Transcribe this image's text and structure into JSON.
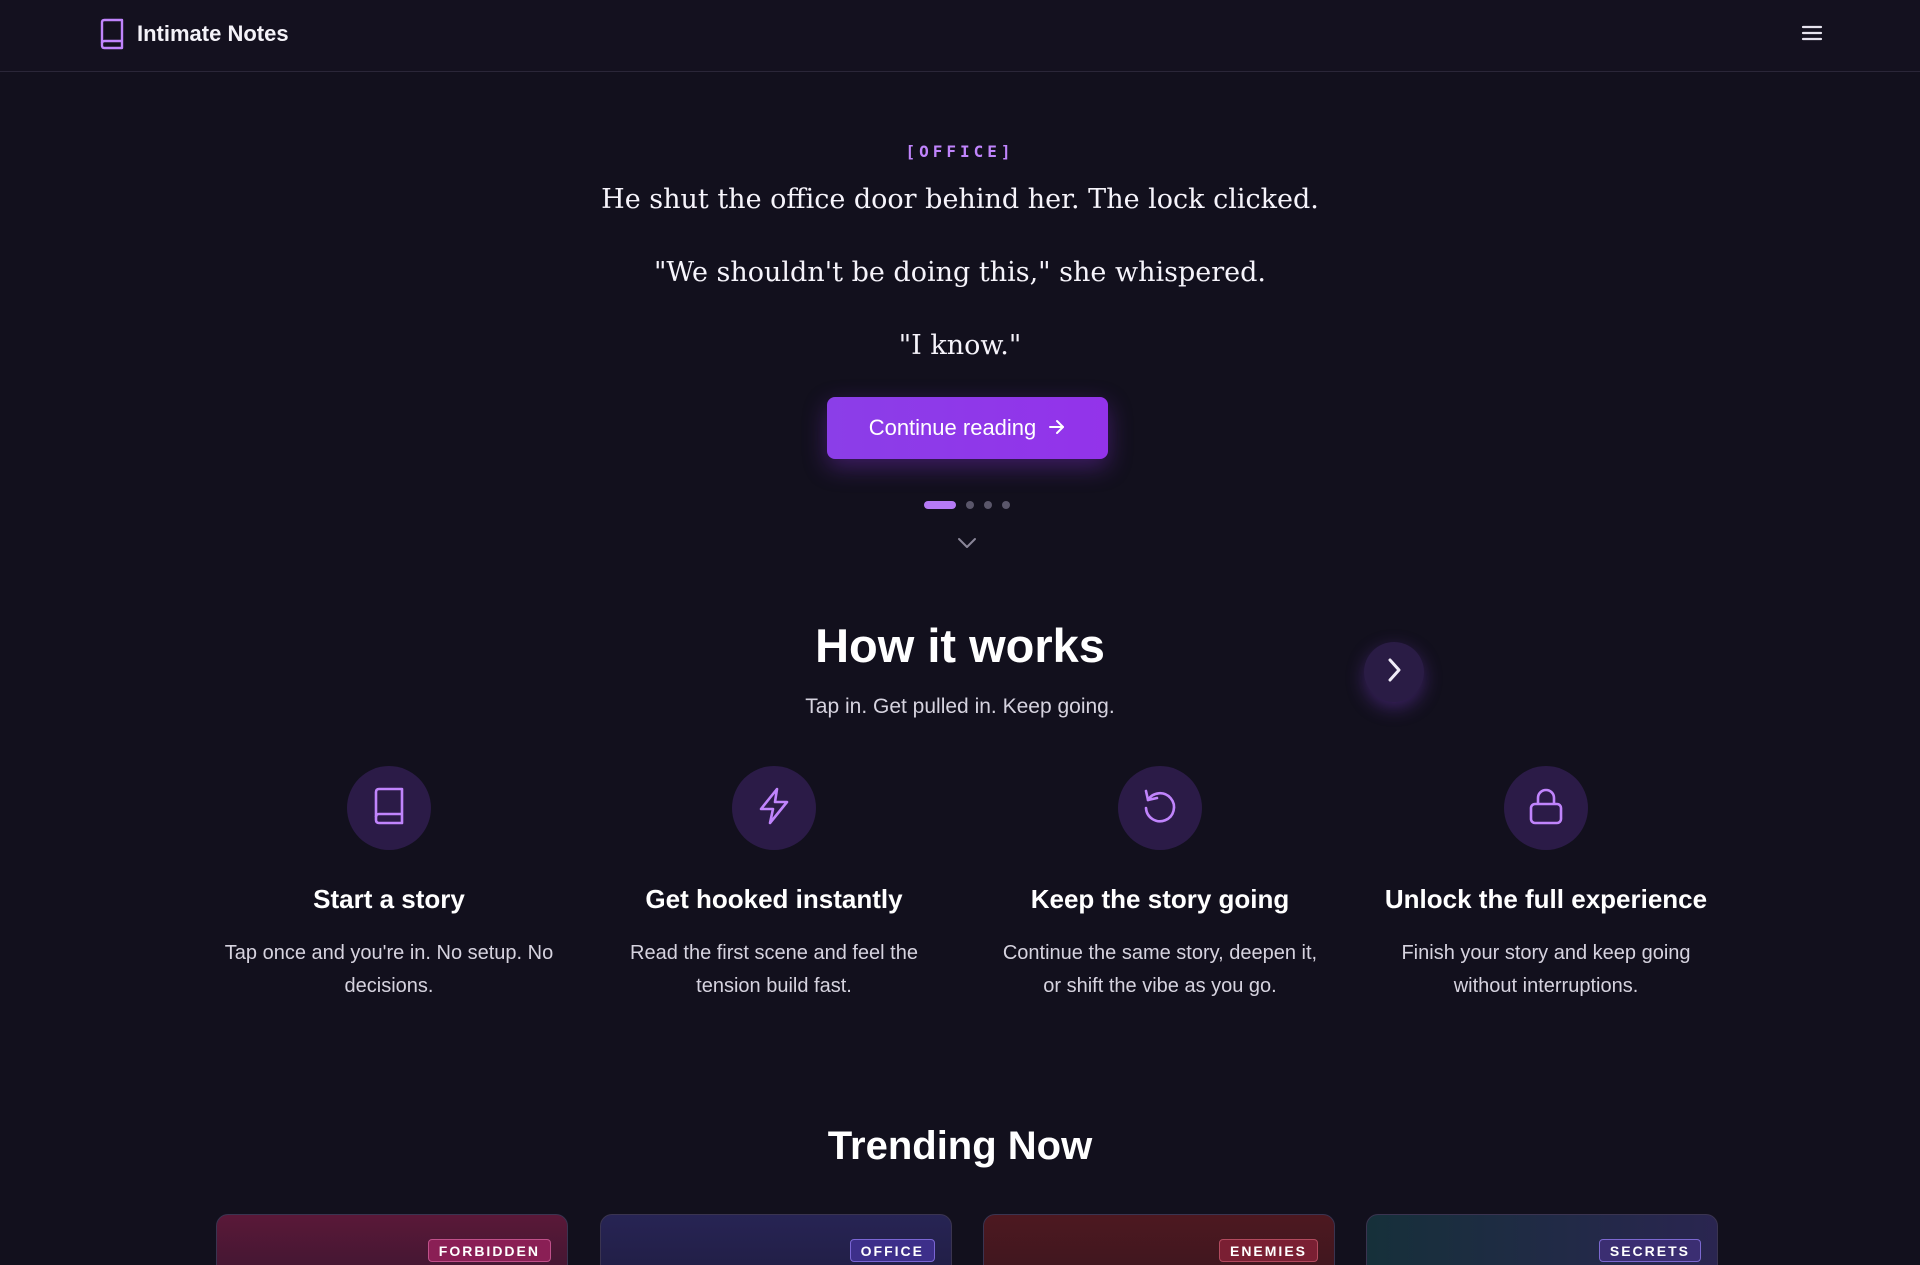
{
  "header": {
    "brand_name": "Intimate Notes",
    "brand_icon": "book-icon",
    "menu_icon": "hamburger-menu-icon"
  },
  "hero": {
    "tag": "[OFFICE]",
    "lines": [
      "He shut the office door behind her. The lock clicked.",
      "\"We shouldn't be doing this,\" she whispered.",
      "\"I know.\""
    ],
    "cta_label": "Continue reading",
    "cta_icon": "arrow-right-icon",
    "carousel": {
      "total": 4,
      "active": 1
    },
    "scroll_icon": "chevron-down-icon"
  },
  "how_it_works": {
    "title": "How it works",
    "subtitle": "Tap in. Get pulled in. Keep going.",
    "next_icon": "chevron-right-icon",
    "steps": [
      {
        "icon": "book-icon",
        "title": "Start a story",
        "desc": "Tap once and you're in. No setup. No decisions."
      },
      {
        "icon": "lightning-icon",
        "title": "Get hooked instantly",
        "desc": "Read the first scene and feel the tension build fast."
      },
      {
        "icon": "refresh-icon",
        "title": "Keep the story going",
        "desc": "Continue the same story, deepen it, or shift the vibe as you go."
      },
      {
        "icon": "lock-icon",
        "title": "Unlock the full experience",
        "desc": "Finish your story and keep going without interruptions."
      }
    ]
  },
  "trending": {
    "title": "Trending Now",
    "cards": [
      {
        "badge": "FORBIDDEN",
        "accent": "#5a1838",
        "badge_bg": "#8a1f55"
      },
      {
        "badge": "OFFICE",
        "accent": "#272454",
        "badge_bg": "#3d2f8a"
      },
      {
        "badge": "ENEMIES",
        "accent": "#4d1820",
        "badge_bg": "#7a1f33"
      },
      {
        "badge": "SECRETS",
        "accent": "#16303a",
        "badge_bg": "#3b2e72"
      }
    ]
  },
  "colors": {
    "background": "#12101d",
    "accent": "#9333ea",
    "accent_light": "#c084fc"
  }
}
